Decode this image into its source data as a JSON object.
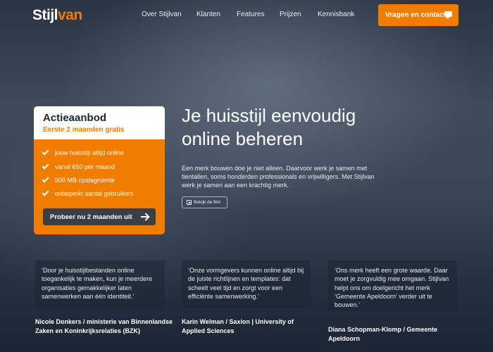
{
  "header": {
    "logo_part1": "Stijl",
    "logo_part2": "van",
    "nav": [
      "Over Stijlvan",
      "Klanten",
      "Features",
      "Prijzen",
      "Kennisbank"
    ],
    "cta_label": "Vragen en contact",
    "cta_icon": "chat-bubble-icon"
  },
  "offer": {
    "title": "Actieaanbod",
    "subtitle": "Eerste 2 maanden gratis",
    "features": [
      "jouw huisstijl altijd online",
      "vanaf €60 per maand",
      "500 MB opslagruimte",
      "onbeperkt aantal gebruikers"
    ],
    "button_label": "Probeer nu 2 maanden uit"
  },
  "hero": {
    "title_line1": "Je huisstijl eenvoudig",
    "title_line2": "online beheren",
    "text": "Een merk bouwen doe je niet alleen. Daarvoor werk je samen met tientallen, soms honderden professionals en vrijwilligers. Met Stijlvan werk je samen aan een krachtig merk.",
    "film_label": "Bekijk de film"
  },
  "testimonials": [
    {
      "quote": "‘Door je huisstijlbestanden online toegankelijk te maken, kun je meerdere organisaties gemakkelijker laten samenwerken aan één identiteit.’",
      "author": "Nicole Donkers / ministerie van Binnenlandse Zaken en Koninkrijksrelaties (BZK)"
    },
    {
      "quote": "‘Onze vormgevers kunnen online altijd bij de juiste richtlijnen en templates: dat scheelt veel tijd en zorgt voor een efficiënte samenwerking.’",
      "author": "Karin Welman / Saxion | University of Applied Sciences"
    },
    {
      "quote": "‘Ons merk heeft een grote waarde. Daar moet je zorgvuldig mee omgaan. Stijlvan helpt ons om doelgericht het merk ‘Gemeente Apeldoorn’ verder uit te bouwen.’",
      "author": "Diana Schopman-Klomp / Gemeente Apeldoorn"
    }
  ],
  "colors": {
    "accent": "#f07d00",
    "dark_button": "#3a3f47",
    "text_dark": "#1f2530"
  }
}
